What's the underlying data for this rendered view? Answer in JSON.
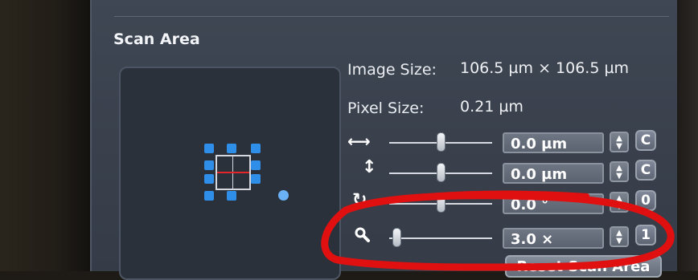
{
  "section": {
    "title": "Scan Area"
  },
  "info": {
    "image_size_label": "Image Size:",
    "image_size_value": "106.5 µm × 106.5 µm",
    "pixel_size_label": "Pixel Size:",
    "pixel_size_value": "0.21 µm"
  },
  "controls": [
    {
      "name": "x-offset",
      "icon": "horizontal-arrows-icon",
      "value": "0.0 µm",
      "button": "C"
    },
    {
      "name": "y-offset",
      "icon": "vertical-arrows-icon",
      "value": "0.0 µm",
      "button": "C"
    },
    {
      "name": "rotation",
      "icon": "rotate-icon",
      "value": "0.0 °",
      "button": "0"
    },
    {
      "name": "zoom",
      "icon": "magnifier-icon",
      "value": "3.0 ×",
      "button": "1"
    }
  ],
  "reset_button": {
    "label": "Reset Scan Area"
  },
  "colors": {
    "panel": "#3a414d",
    "handle": "#2f8fe8",
    "scan_line": "#e3262a",
    "annotation": "#e01010"
  }
}
